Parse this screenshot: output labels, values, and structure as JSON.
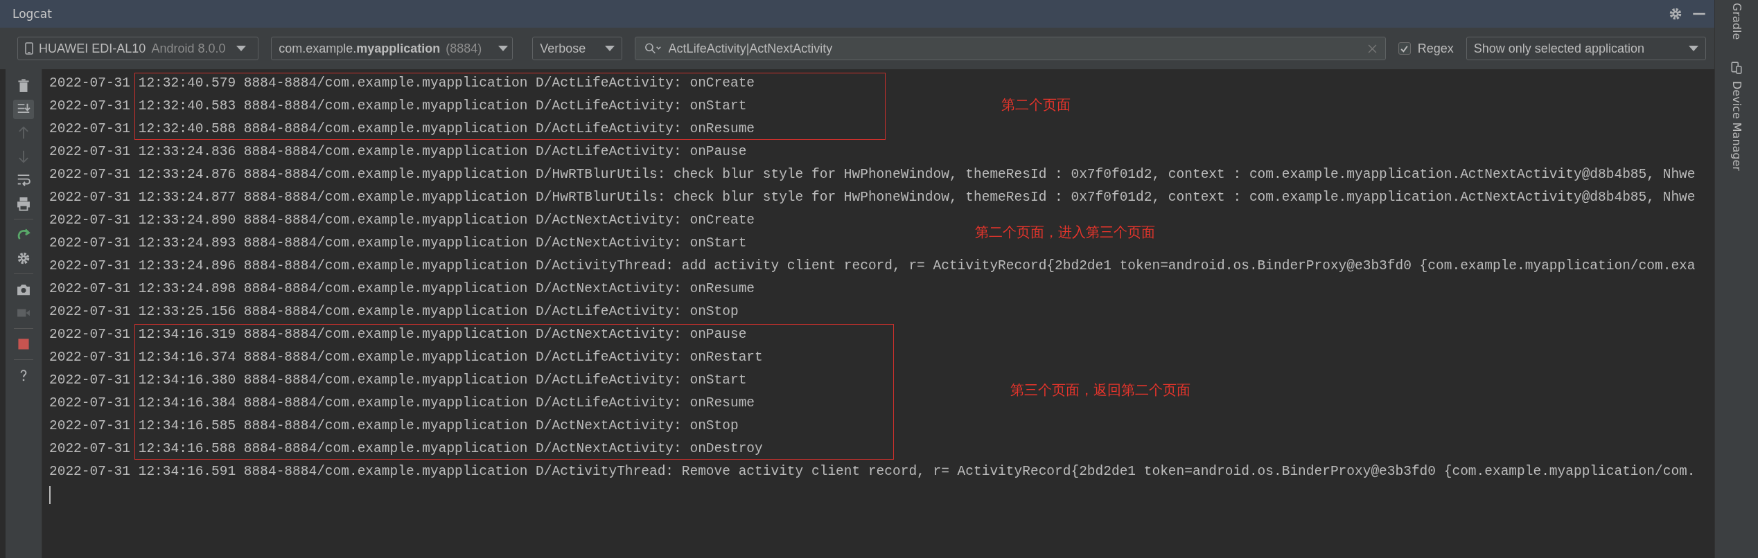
{
  "window": {
    "title": "Logcat"
  },
  "title_actions": [
    {
      "kind": "settings"
    },
    {
      "kind": "minimize"
    }
  ],
  "toolbar": {
    "device": {
      "name": "HUAWEI EDI-AL10",
      "os": "Android 8.0.0"
    },
    "process": {
      "package": "com.example.**myapplication**",
      "pid": "(8884)"
    },
    "level": "Verbose",
    "search": {
      "value": "ActLifeActivity|ActNextActivity"
    },
    "regex": {
      "label": "Regex",
      "checked": true
    },
    "filter": "Show only selected application"
  },
  "side_tools": [
    {
      "kind": "trash",
      "disabled": false,
      "selected": false
    },
    {
      "kind": "scroll-end",
      "disabled": false,
      "selected": true
    },
    {
      "kind": "up",
      "disabled": true,
      "selected": false
    },
    {
      "kind": "down",
      "disabled": true,
      "selected": false
    },
    {
      "kind": "wrap",
      "disabled": false,
      "selected": false
    },
    {
      "kind": "print",
      "disabled": false,
      "selected": false
    },
    {
      "kind": "divider"
    },
    {
      "kind": "restart",
      "disabled": false,
      "selected": false
    },
    {
      "kind": "settings",
      "disabled": false,
      "selected": false
    },
    {
      "kind": "divider"
    },
    {
      "kind": "camera",
      "disabled": false,
      "selected": false
    },
    {
      "kind": "video",
      "disabled": true,
      "selected": false
    },
    {
      "kind": "divider"
    },
    {
      "kind": "stop",
      "disabled": false,
      "selected": false
    },
    {
      "kind": "divider"
    },
    {
      "kind": "help",
      "disabled": false,
      "selected": false
    }
  ],
  "log": [
    {
      "kind": "boxed",
      "note": "第二个页面",
      "lines": [
        "2022-07-31 12:32:40.579 8884-8884/com.example.myapplication D/ActLifeActivity: onCreate",
        "2022-07-31 12:32:40.583 8884-8884/com.example.myapplication D/ActLifeActivity: onStart",
        "2022-07-31 12:32:40.588 8884-8884/com.example.myapplication D/ActLifeActivity: onResume"
      ]
    },
    {
      "kind": "plain",
      "lines": [
        "2022-07-31 12:33:24.836 8884-8884/com.example.myapplication D/ActLifeActivity: onPause",
        "2022-07-31 12:33:24.876 8884-8884/com.example.myapplication D/HwRTBlurUtils: check blur style for HwPhoneWindow, themeResId : 0x7f0f01d2, context : com.example.myapplication.ActNextActivity@d8b4b85, Nhwe",
        "2022-07-31 12:33:24.877 8884-8884/com.example.myapplication D/HwRTBlurUtils: check blur style for HwPhoneWindow, themeResId : 0x7f0f01d2, context : com.example.myapplication.ActNextActivity@d8b4b85, Nhwe",
        "2022-07-31 12:33:24.890 8884-8884/com.example.myapplication D/ActNextActivity: onCreate"
      ]
    },
    {
      "kind": "note",
      "note": "第二个页面，进入第三个页面"
    },
    {
      "kind": "plain",
      "lines": [
        "2022-07-31 12:33:24.893 8884-8884/com.example.myapplication D/ActNextActivity: onStart",
        "2022-07-31 12:33:24.896 8884-8884/com.example.myapplication D/ActivityThread: add activity client record, r= ActivityRecord{2bd2de1 token=android.os.BinderProxy@e3b3fd0 {com.example.myapplication/com.exa",
        "2022-07-31 12:33:24.898 8884-8884/com.example.myapplication D/ActNextActivity: onResume",
        "2022-07-31 12:33:25.156 8884-8884/com.example.myapplication D/ActLifeActivity: onStop"
      ]
    },
    {
      "kind": "boxed",
      "note": "第三个页面，返回第二个页面",
      "lines": [
        "2022-07-31 12:34:16.319 8884-8884/com.example.myapplication D/ActNextActivity: onPause",
        "2022-07-31 12:34:16.374 8884-8884/com.example.myapplication D/ActLifeActivity: onRestart",
        "2022-07-31 12:34:16.380 8884-8884/com.example.myapplication D/ActLifeActivity: onStart",
        "2022-07-31 12:34:16.384 8884-8884/com.example.myapplication D/ActLifeActivity: onResume",
        "2022-07-31 12:34:16.585 8884-8884/com.example.myapplication D/ActNextActivity: onStop",
        "2022-07-31 12:34:16.588 8884-8884/com.example.myapplication D/ActNextActivity: onDestroy"
      ]
    },
    {
      "kind": "plain",
      "lines": [
        "2022-07-31 12:34:16.591 8884-8884/com.example.myapplication D/ActivityThread: Remove activity client record, r= ActivityRecord{2bd2de1 token=android.os.BinderProxy@e3b3fd0 {com.example.myapplication/com."
      ]
    }
  ],
  "right_panel": [
    {
      "kind": "tab",
      "label": "Gradle"
    },
    {
      "kind": "icon-tab",
      "label": "Device Manager"
    }
  ]
}
